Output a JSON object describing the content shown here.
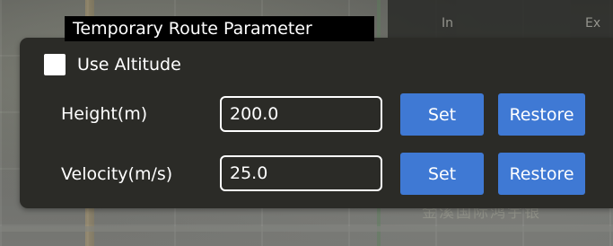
{
  "dialog": {
    "title": "Temporary Route Parameter",
    "use_altitude": {
      "label": "Use Altitude",
      "checked": false
    }
  },
  "rows": [
    {
      "label": "Height(m)",
      "value": "200.0",
      "set_label": "Set",
      "restore_label": "Restore"
    },
    {
      "label": "Velocity(m/s)",
      "value": "25.0",
      "set_label": "Set",
      "restore_label": "Restore"
    }
  ],
  "background": {
    "top_texts": [
      "In",
      "Ex"
    ],
    "bottom_text": "金溪国际鸿宇银"
  },
  "colors": {
    "panel": "#2b2b27",
    "button": "#3f79d4",
    "title_bg": "#000000",
    "text": "#ffffff"
  }
}
